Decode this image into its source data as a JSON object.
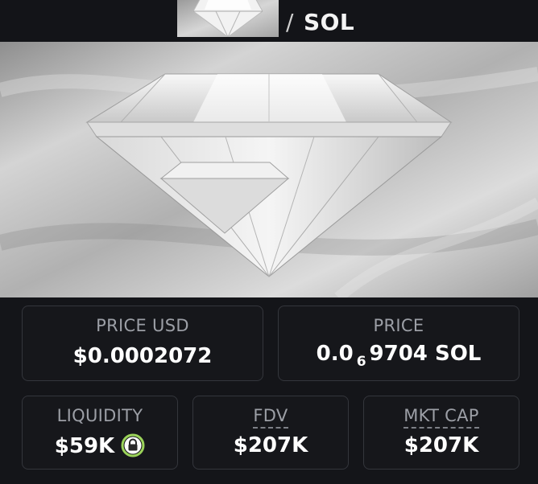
{
  "header": {
    "pair_separator": "/",
    "quote_symbol": "SOL",
    "thumbnail_icon": "diamond-thumbnail-icon"
  },
  "banner": {
    "image_icon": "diamond-banner-image"
  },
  "stats": {
    "price_usd": {
      "label": "PRICE USD",
      "value": "$0.0002072"
    },
    "price": {
      "label": "PRICE",
      "prefix": "0.0",
      "zeros": "6",
      "digits": "9704",
      "unit": "SOL"
    },
    "liquidity": {
      "label": "LIQUIDITY",
      "value": "$59K",
      "badge_icon": "lock-icon",
      "badge_color": "#9bd35a"
    },
    "fdv": {
      "label": "FDV",
      "value": "$207K"
    },
    "mkt_cap": {
      "label": "MKT CAP",
      "value": "$207K"
    }
  },
  "colors": {
    "background": "#141519",
    "card_border": "#34363c",
    "label": "#9c9fa6",
    "accent_green": "#9bd35a"
  }
}
